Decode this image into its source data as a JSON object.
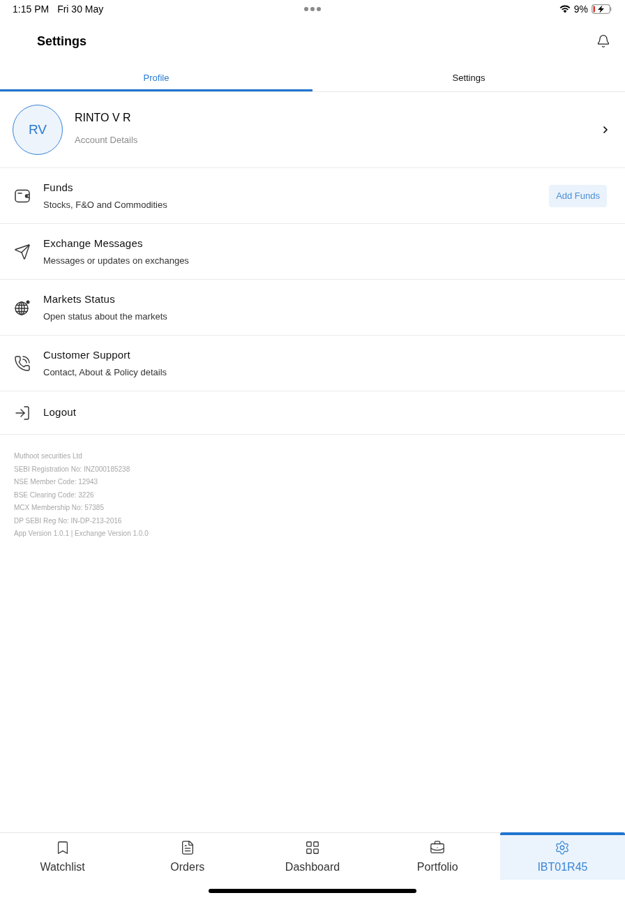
{
  "status_bar": {
    "time": "1:15 PM",
    "date": "Fri 30 May",
    "battery": "9%"
  },
  "header": {
    "title": "Settings"
  },
  "tabs": [
    {
      "label": "Profile",
      "selected": true
    },
    {
      "label": "Settings",
      "selected": false
    }
  ],
  "profile": {
    "initials": "RV",
    "name": "RINTO V R",
    "subtitle": "Account Details"
  },
  "menu": [
    {
      "title": "Funds",
      "subtitle": "Stocks, F&O and Commodities",
      "action": "Add Funds"
    },
    {
      "title": "Exchange Messages",
      "subtitle": "Messages or updates on exchanges"
    },
    {
      "title": "Markets Status",
      "subtitle": "Open status about the markets"
    },
    {
      "title": "Customer Support",
      "subtitle": "Contact, About & Policy details"
    },
    {
      "title": "Logout"
    }
  ],
  "footer": [
    "Muthoot securities Ltd",
    "SEBI Registration No: INZ000185238",
    "NSE Member Code: 12943",
    "BSE Clearing Code: 3226",
    "MCX Membership No: 57385",
    "DP SEBI Reg No: IN-DP-213-2016",
    "App Version 1.0.1 | Exchange Version 1.0.0"
  ],
  "nav": [
    {
      "label": "Watchlist",
      "selected": false
    },
    {
      "label": "Orders",
      "selected": false
    },
    {
      "label": "Dashboard",
      "selected": false
    },
    {
      "label": "Portfolio",
      "selected": false
    },
    {
      "label": "IBT01R45",
      "selected": true
    }
  ]
}
